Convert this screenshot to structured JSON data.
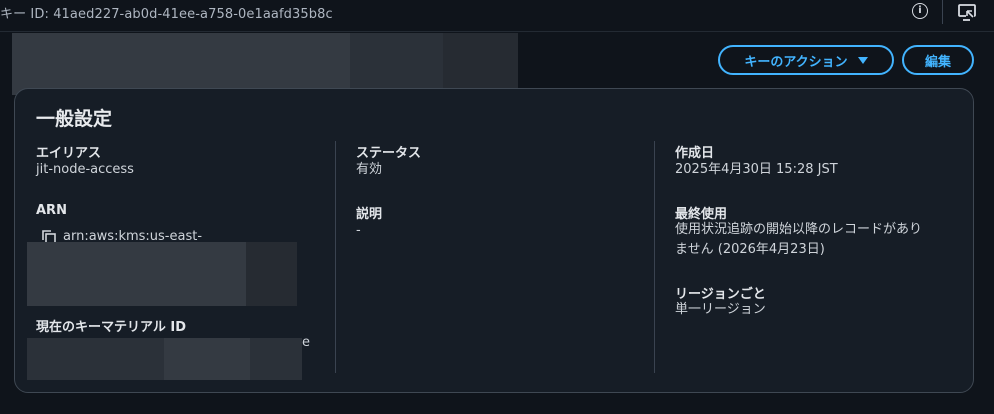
{
  "header": {
    "key_id_text": "キー ID: 41aed227-ab0d-41ee-a758-0e1aafd35b8c",
    "info_icon": "info-icon",
    "screen_icon": "screen-icon"
  },
  "actions": {
    "key_actions_label": "キーのアクション",
    "edit_label": "編集"
  },
  "general": {
    "title": "一般設定",
    "alias": {
      "label": "エイリアス",
      "value": "jit-node-access"
    },
    "arn": {
      "label": "ARN",
      "value": "arn:aws:kms:us-east-"
    },
    "key_material": {
      "label": "現在のキーマテリアル ID",
      "value_tail": "e"
    },
    "status": {
      "label": "ステータス",
      "value": "有効"
    },
    "description": {
      "label": "説明",
      "value": "-"
    },
    "created": {
      "label": "作成日",
      "value": "2025年4月30日 15:28 JST"
    },
    "last_used": {
      "label": "最終使用",
      "value_line1": "使用状況追跡の開始以降のレコードがあり",
      "value_line2": "ません (2026年4月23日)"
    },
    "region": {
      "label": "リージョンごと",
      "value": "単一リージョン"
    }
  },
  "colors": {
    "accent": "#42b4ff",
    "background": "#0f141b",
    "card": "#161d26"
  }
}
